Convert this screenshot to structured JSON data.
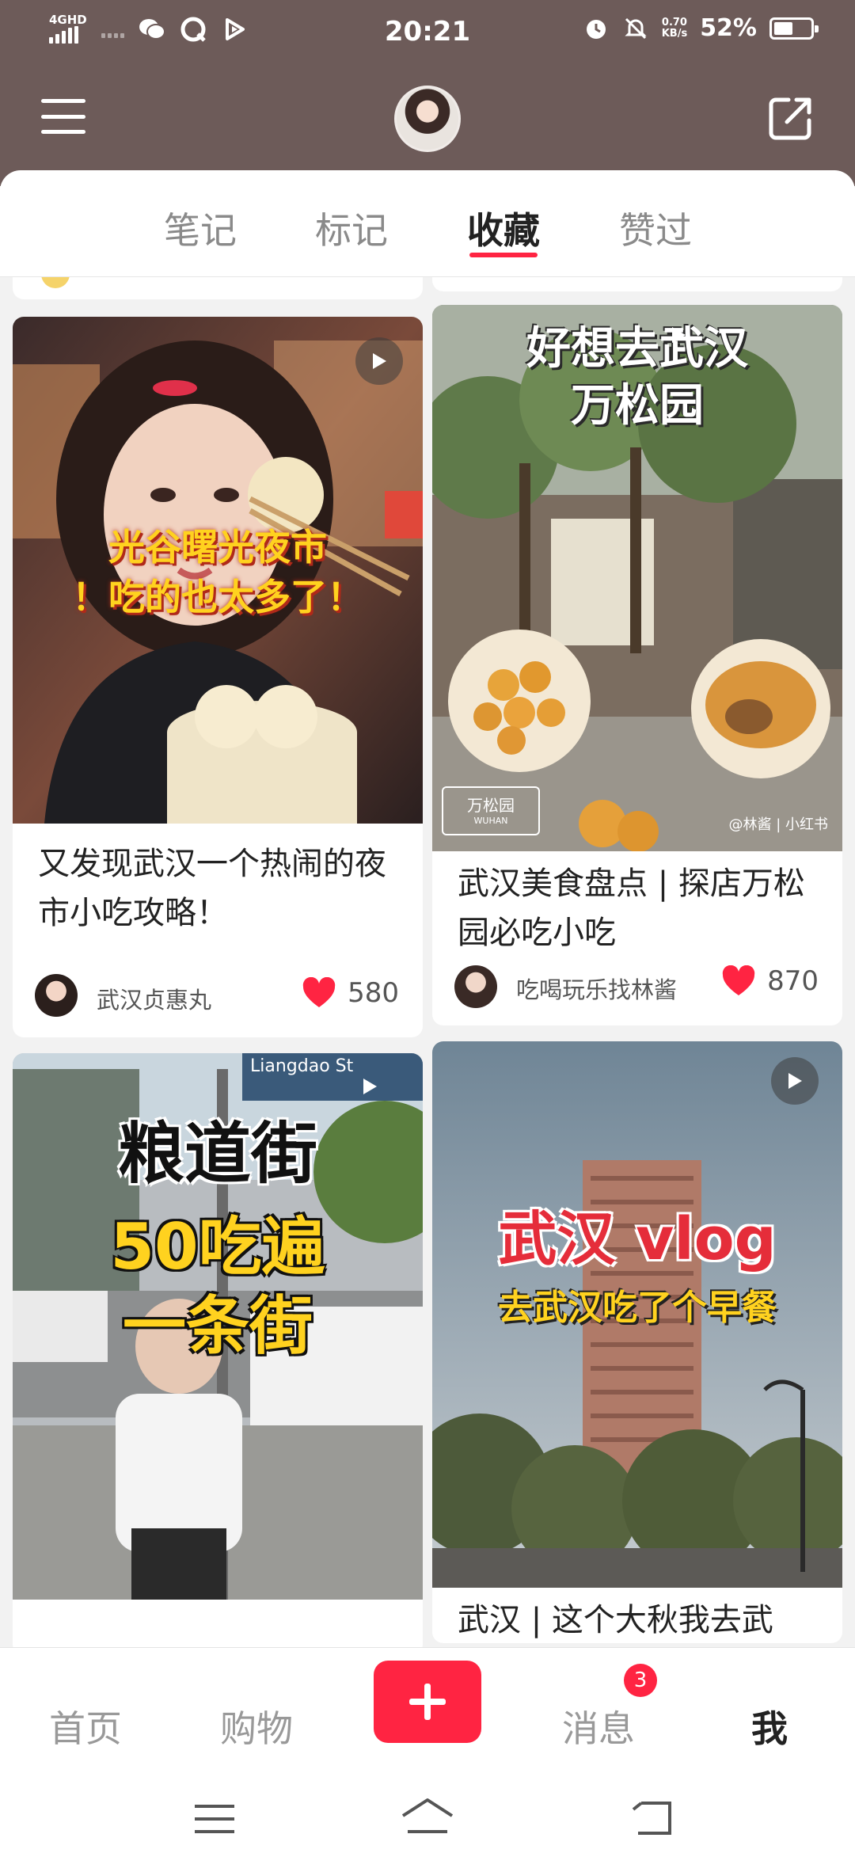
{
  "status_bar": {
    "network": "4GHD",
    "time": "20:21",
    "speed_value": "0.70",
    "speed_unit": "KB/s",
    "battery": "52%",
    "battery_level": 0.52
  },
  "tabs": [
    {
      "label": "笔记",
      "active": false
    },
    {
      "label": "标记",
      "active": false
    },
    {
      "label": "收藏",
      "active": true
    },
    {
      "label": "赞过",
      "active": false
    }
  ],
  "cards": [
    {
      "title": "又发现武汉一个热闹的夜市小吃攻略！",
      "overlay_line1": "光谷曙光夜市",
      "overlay_line2": "！吃的也太多了！",
      "author": "武汉贞惠丸",
      "likes": "580"
    },
    {
      "title": "武汉美食盘点 | 探店万松园必吃小吃",
      "overlay_line1": "好想去武汉",
      "overlay_line2": "万松园",
      "tag": "万松园",
      "tag_sub": "WUHAN",
      "watermark": "@林酱 | 小红书",
      "author": "吃喝玩乐找林酱",
      "likes": "870"
    },
    {
      "overlay_line1": "粮道街",
      "overlay_line2": "50吃遍",
      "overlay_line3": "一条街",
      "street_sign": "Liangdao St"
    },
    {
      "overlay_line1": "武汉 vlog",
      "overlay_line2": "去武汉吃了个早餐",
      "title_partial": "武汉 | 这个大秋我去武"
    }
  ],
  "bottom_nav": [
    {
      "label": "首页",
      "active": false
    },
    {
      "label": "购物",
      "active": false
    },
    {
      "label": "消息",
      "active": false,
      "badge": "3"
    },
    {
      "label": "我",
      "active": true
    }
  ],
  "colors": {
    "header": "#6d5b59",
    "accent": "#ff2442"
  }
}
